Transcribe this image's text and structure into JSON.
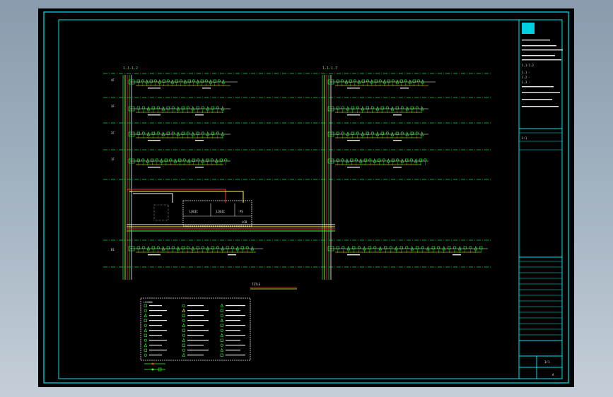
{
  "colors": {
    "background": "#000000",
    "frame": "#00e5ee",
    "grid": "#00dd44",
    "component": "#33ff33",
    "text": "#e8e8e8",
    "riser_red": "#ff3030",
    "riser_yellow": "#ffff40",
    "riser_white": "#ffffff"
  },
  "drawing": {
    "riser_left_label": "1.1-1.2",
    "riser_right_label": "1.1-1.7",
    "floor_levels": [
      "4F",
      "3F",
      "2F",
      "1F",
      "B1"
    ],
    "level_row_labels": [
      "4F",
      "3F",
      "2F",
      "1F",
      "B1"
    ],
    "panel_labels": [
      "LOGIC",
      "LOGIC",
      "PS"
    ],
    "panel_bottom_label": "LCB",
    "schedule_title": "TITLE",
    "legend_title": "LEGEND"
  },
  "title_block": {
    "company_line": "1.1-1.2",
    "notes": [
      "1.1 -",
      "1.2 -",
      "1.3 -"
    ],
    "sheet_no": "1/1",
    "scale": "1:1",
    "rev": "A"
  }
}
